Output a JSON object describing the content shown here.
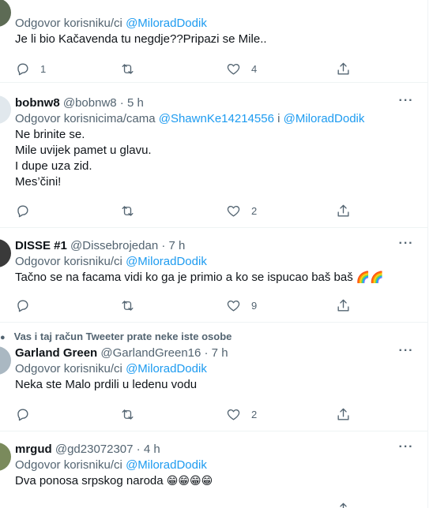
{
  "tweets": [
    {
      "reply_label": "Odgovor korisniku/ci",
      "mentions": [
        "@MiloradDodik"
      ],
      "text_lines": [
        "Je li bio Kačavenda tu negdje??Pripazi se Mile.."
      ],
      "replies": "1",
      "retweets": "",
      "likes": "4"
    },
    {
      "name": "bobnw8",
      "handle": "@bobnw8",
      "time": "· 5 h",
      "reply_label": "Odgovor korisnicima/cama",
      "mentions": [
        "@ShawnKe14214556",
        "i",
        "@MiloradDodik"
      ],
      "text_lines": [
        "Ne brinite se.",
        "Mile uvijek pamet u glavu.",
        "I dupe uza zid.",
        "Mes’čini!"
      ],
      "replies": "",
      "retweets": "",
      "likes": "2"
    },
    {
      "name": "DISSE #1",
      "handle": "@Dissebrojedan",
      "time": "· 7 h",
      "reply_label": "Odgovor korisniku/ci",
      "mentions": [
        "@MiloradDodik"
      ],
      "text_lines": [
        "Tačno se na facama vidi ko ga je primio a ko se ispucao baš baš"
      ],
      "emoji": "🌈🌈",
      "replies": "",
      "retweets": "",
      "likes": "9"
    },
    {
      "social_context": "Vas i taj račun Tweeter prate neke iste osobe",
      "name": "Garland Green",
      "handle": "@GarlandGreen16",
      "time": "· 7 h",
      "reply_label": "Odgovor korisniku/ci",
      "mentions": [
        "@MiloradDodik"
      ],
      "text_lines": [
        "Neka ste Malo prdili u ledenu vodu"
      ],
      "replies": "",
      "retweets": "",
      "likes": "2"
    },
    {
      "name": "mrgud",
      "handle": "@gd23072307",
      "time": "· 4 h",
      "reply_label": "Odgovor korisniku/ci",
      "mentions": [
        "@MiloradDodik"
      ],
      "text_lines": [
        "Dva ponosa srpskog naroda"
      ],
      "emoji": "😁😁😁😁"
    }
  ],
  "icons": {
    "reply": "reply-icon",
    "retweet": "retweet-icon",
    "like": "heart-icon",
    "share": "share-icon",
    "more": "more-icon",
    "social": "person-icon"
  },
  "colors": {
    "link": "#1d9bf0",
    "secondary_text": "#536471",
    "primary_text": "#0f1419",
    "divider": "#eff3f4"
  }
}
